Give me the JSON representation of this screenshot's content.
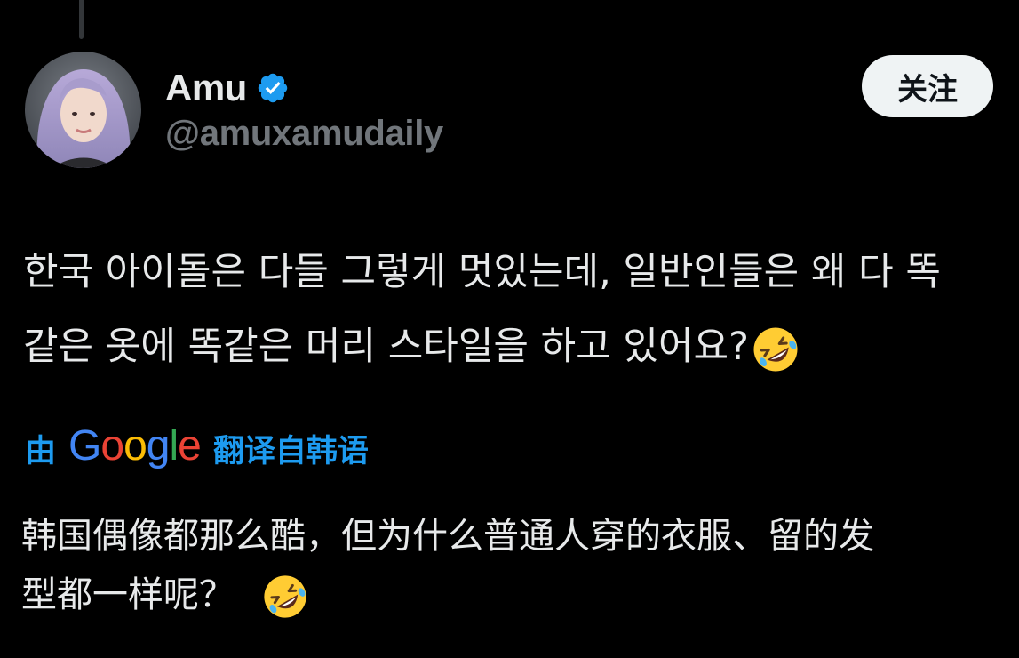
{
  "author": {
    "display_name": "Amu",
    "handle": "@amuxamudaily",
    "verified_icon": "verified-badge-icon",
    "avatar": "profile-photo"
  },
  "actions": {
    "follow_label": "关注"
  },
  "tweet": {
    "line1": "한국 아이돌은 다들 그렇게 멋있는데, 일반인들은 왜 다 똑",
    "line2": "같은 옷에 똑같은 머리 스타일을 하고 있어요?",
    "emoji": "rolling-on-floor-laughing-icon"
  },
  "translation": {
    "prefix": "由",
    "provider": "Google",
    "suffix": "翻译自韩语",
    "line1": "韩国偶像都那么酷，但为什么普通人穿的衣服、留的发",
    "line2": "型都一样呢？"
  },
  "colors": {
    "background": "#000000",
    "text": "#e7e9ea",
    "secondary_text": "#71767b",
    "accent": "#1d9bf0",
    "follow_button_bg": "#eff3f4"
  }
}
